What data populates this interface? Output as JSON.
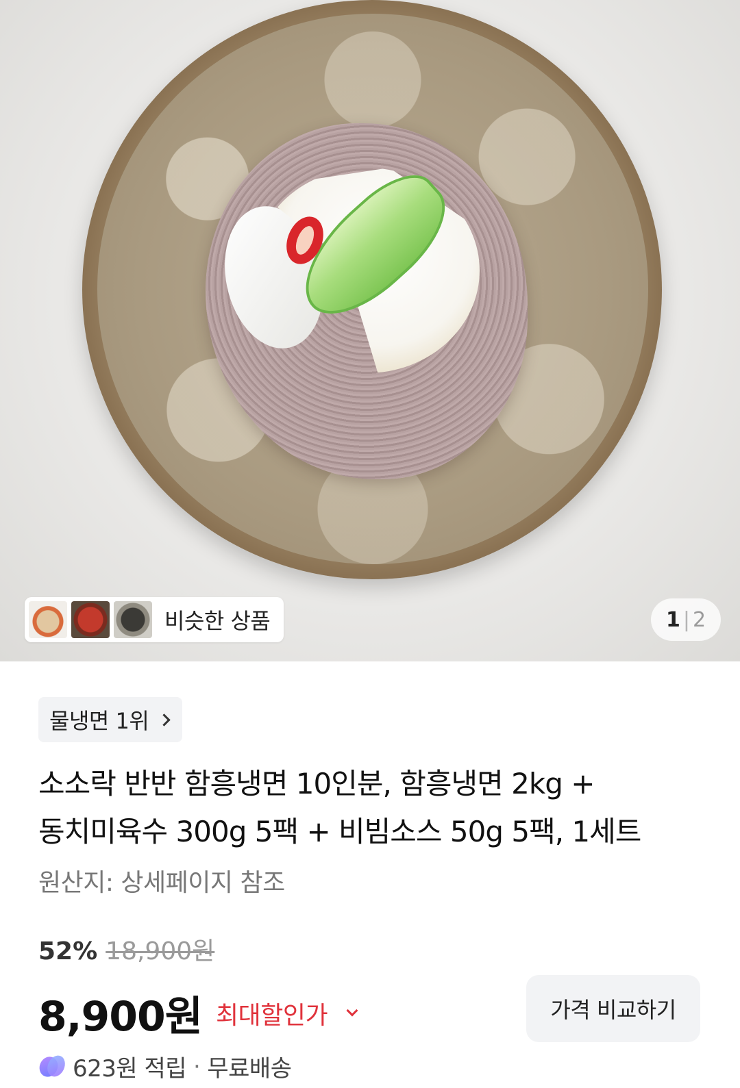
{
  "gallery": {
    "similar_label": "비슷한 상품",
    "page_current": "1",
    "page_separator": "|",
    "page_total": "2"
  },
  "product": {
    "rank_badge": "물냉면 1위",
    "title_line1": "소소락 반반 함흥냉면 10인분, 함흥냉면 2kg +",
    "title_line2": "동치미육수 300g 5팩 + 비빔소스 50g 5팩, 1세트",
    "origin": "원산지: 상세페이지 참조",
    "discount_rate": "52%",
    "original_price": "18,900원",
    "price": "8,900원",
    "max_discount_label": "최대할인가",
    "compare_button": "가격 비교하기",
    "points": "623원 적립",
    "separator": "·",
    "shipping": "무료배송"
  },
  "colors": {
    "accent_red": "#e0323b",
    "badge_bg": "#f2f3f5"
  }
}
